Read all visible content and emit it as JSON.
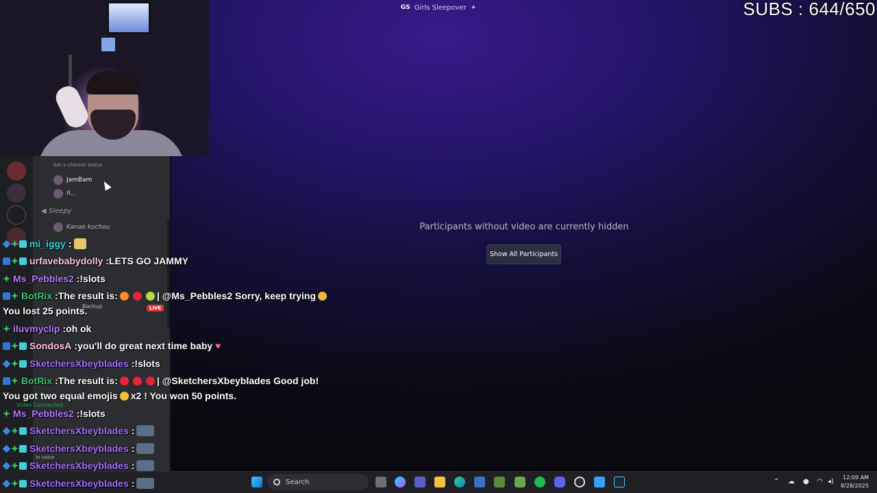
{
  "window": {
    "server_tag": "GS",
    "title": "Girls Sleepover"
  },
  "overlay": {
    "subs": "SUBS : 644/650"
  },
  "stage": {
    "hidden_message": "Participants without video are currently hidden",
    "show_all_label": "Show All Participants"
  },
  "sidebar": {
    "channel_status": "Set a channel status",
    "member_jambam": "JamBam",
    "member_r": "R...",
    "channel_sleepy": "Sleepy",
    "member_kanae": "Kanae kochou",
    "live_badge": "LIVE",
    "backup": "Backup",
    "voice_status": "Video Connected",
    "in_voice": "In voice"
  },
  "chat": [
    {
      "user": "mi_iggy",
      "color": "#3fd0d8",
      "sep": " : ",
      "text": ""
    },
    {
      "user": "urfavebabydolly",
      "color": "#ffc7de",
      "sep": " : ",
      "text": "LETS GO JAMMY"
    },
    {
      "user": "Ms_Pebbles2",
      "color": "#b579ff",
      "sep": " : ",
      "text": "!slots"
    },
    {
      "user": "BotRix",
      "color": "#3ec46d",
      "sep": " : ",
      "text": "The result is:",
      "text2": "| @Ms_Pebbles2 Sorry, keep trying"
    },
    {
      "user": "",
      "color": "#ffffff",
      "sep": "",
      "text": "You lost 25 points."
    },
    {
      "user": "iluvmyclip",
      "color": "#b579ff",
      "sep": " : ",
      "text": "oh ok"
    },
    {
      "user": "SondosA",
      "color": "#ffc7de",
      "sep": " : ",
      "text": "you'll do great next time baby"
    },
    {
      "user": "SketchersXbeyblades",
      "color": "#a56cff",
      "sep": " : ",
      "text": "!slots"
    },
    {
      "user": "BotRix",
      "color": "#3ec46d",
      "sep": " : ",
      "text": "The result is:",
      "text2": "| @SketchersXbeyblades Good job!"
    },
    {
      "user": "",
      "color": "#ffffff",
      "sep": "",
      "text": "You got two equal emojis",
      "text2": "x2 ! You won 50 points."
    },
    {
      "user": "Ms_Pebbles2",
      "color": "#b579ff",
      "sep": " : ",
      "text": "!slots"
    },
    {
      "user": "SketchersXbeyblades",
      "color": "#a56cff",
      "sep": " : ",
      "text": ""
    },
    {
      "user": "SketchersXbeyblades",
      "color": "#a56cff",
      "sep": " : ",
      "text": ""
    },
    {
      "user": "SketchersXbeyblades",
      "color": "#a56cff",
      "sep": " : ",
      "text": ""
    },
    {
      "user": "SketchersXbeyblades",
      "color": "#a56cff",
      "sep": " : ",
      "text": ""
    }
  ],
  "taskbar": {
    "search_placeholder": "Search",
    "time": "12:09 AM",
    "date": "8/28/2025"
  }
}
